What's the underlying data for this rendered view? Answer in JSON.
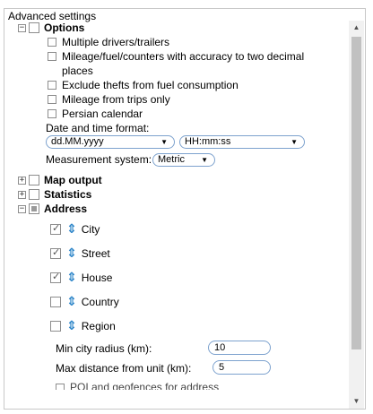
{
  "panel": {
    "legend": "Advanced settings"
  },
  "options": {
    "title": "Options",
    "items": [
      {
        "label": "Multiple drivers/trailers",
        "checked": false
      },
      {
        "label": "Mileage/fuel/counters with accuracy to two decimal",
        "checked": false
      },
      {
        "label": "places",
        "checked": false
      },
      {
        "label": "Exclude thefts from fuel consumption",
        "checked": false
      },
      {
        "label": "Mileage from trips only",
        "checked": false
      },
      {
        "label": "Persian calendar",
        "checked": false
      }
    ],
    "date_time_label": "Date and time format:",
    "date_format": "dd.MM.yyyy",
    "time_format": "HH:mm:ss",
    "measurement_label": "Measurement system:",
    "measurement_value": "Metric"
  },
  "sections": [
    {
      "label": "Map output",
      "expanded": false
    },
    {
      "label": "Statistics",
      "expanded": false
    },
    {
      "label": "Address",
      "expanded": true
    }
  ],
  "address": {
    "fields": [
      {
        "label": "City",
        "checked": true
      },
      {
        "label": "Street",
        "checked": true
      },
      {
        "label": "House",
        "checked": true
      },
      {
        "label": "Country",
        "checked": false
      },
      {
        "label": "Region",
        "checked": false
      }
    ],
    "min_city_radius_label": "Min city radius (km):",
    "min_city_radius_value": "10",
    "max_distance_label": "Max distance from unit (km):",
    "max_distance_value": "5",
    "truncated_row": "POI and geofences for address"
  },
  "icons": {
    "expand": "+",
    "collapse": "−",
    "drag": "⇕"
  }
}
